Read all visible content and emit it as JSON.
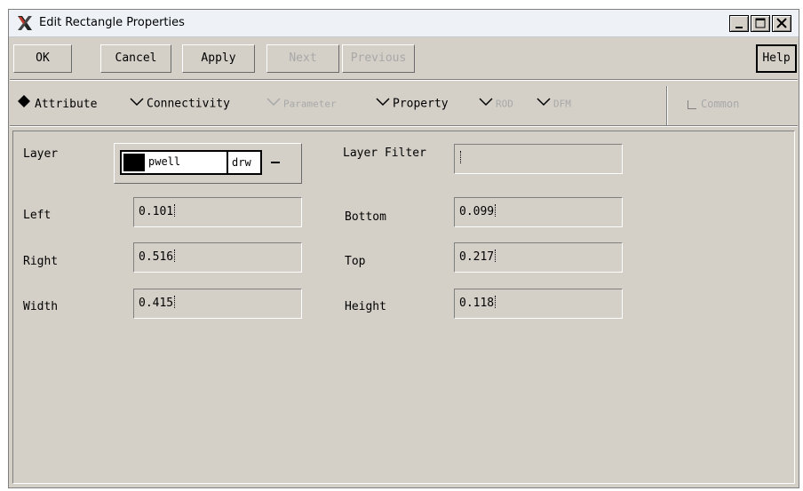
{
  "window": {
    "title": "Edit Rectangle Properties"
  },
  "toolbar": {
    "ok": "OK",
    "cancel": "Cancel",
    "apply": "Apply",
    "next": "Next",
    "previous": "Previous",
    "help": "Help"
  },
  "tabs": {
    "attribute": "Attribute",
    "connectivity": "Connectivity",
    "parameter": "Parameter",
    "property": "Property",
    "rod": "ROD",
    "dfm": "DFM",
    "selected": "Attribute"
  },
  "common": "Common",
  "form": {
    "layer_label": "Layer",
    "layer_name": "pwell",
    "layer_purpose": "drw",
    "layer_color": "#000000",
    "layer_filter_label": "Layer Filter",
    "layer_filter_value": "",
    "left_label": "Left",
    "left_value": "0.101",
    "right_label": "Right",
    "right_value": "0.516",
    "width_label": "Width",
    "width_value": "0.415",
    "bottom_label": "Bottom",
    "bottom_value": "0.099",
    "top_label": "Top",
    "top_value": "0.217",
    "height_label": "Height",
    "height_value": "0.118"
  },
  "icons": [
    "app-x-icon",
    "minimize-icon",
    "maximize-icon",
    "close-icon",
    "layer-dropdown-icon"
  ]
}
